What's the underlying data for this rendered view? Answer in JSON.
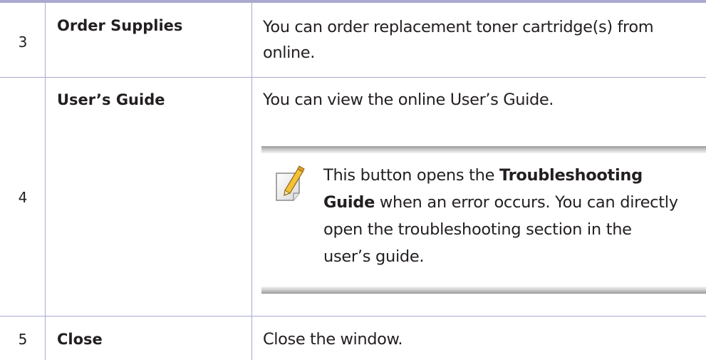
{
  "rows": [
    {
      "number": "3",
      "name": "Order Supplies",
      "description_line1": "You can order replacement toner cartridge(s) from",
      "description_line2": "online."
    },
    {
      "number": "4",
      "name": "User’s Guide",
      "description": "You can view the online User’s Guide.",
      "note": {
        "icon": "note-pencil-icon",
        "text_before": "This button opens the ",
        "bold1": "Troubleshooting",
        "bold2": "Guide",
        "text_after_line2": " when an error occurs. You can directly",
        "line3": "open the troubleshooting section in the",
        "line4": "user’s guide."
      }
    },
    {
      "number": "5",
      "name": "Close",
      "description": "Close the window."
    }
  ],
  "colors": {
    "rule": "#a9a9cf",
    "text": "#231f20"
  }
}
